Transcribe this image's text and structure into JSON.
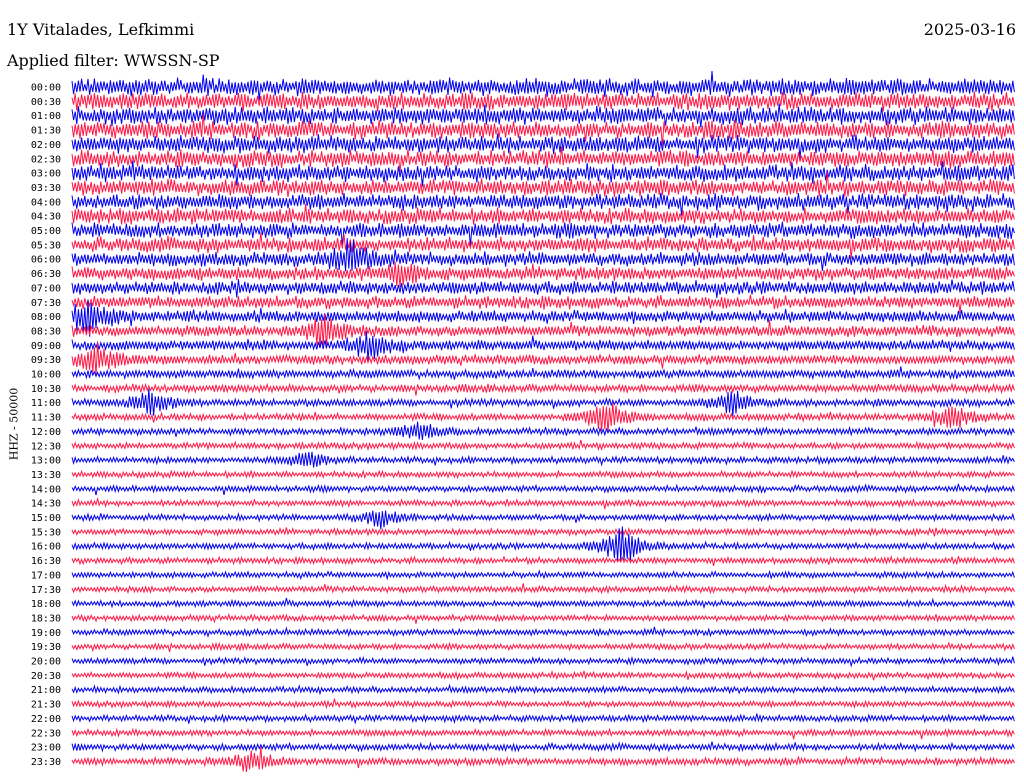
{
  "header": {
    "title": "1Y Vitalades, Lefkimmi",
    "date": "2025-03-16",
    "filter": "Applied filter: WWSSN-SP"
  },
  "chart_data": {
    "type": "line",
    "ylabel": "HHZ - 50000",
    "ytick_labels": [
      "00:00",
      "00:30",
      "01:00",
      "01:30",
      "02:00",
      "02:30",
      "03:00",
      "03:30",
      "04:00",
      "04:30",
      "05:00",
      "05:30",
      "06:00",
      "06:30",
      "07:00",
      "07:30",
      "08:00",
      "08:30",
      "09:00",
      "09:30",
      "10:00",
      "10:30",
      "11:00",
      "11:30",
      "12:00",
      "12:30",
      "13:00",
      "13:30",
      "14:00",
      "14:30",
      "15:00",
      "15:30",
      "16:00",
      "16:30",
      "17:00",
      "17:30",
      "18:00",
      "18:30",
      "19:00",
      "19:30",
      "20:00",
      "20:30",
      "21:00",
      "21:30",
      "22:00",
      "22:30",
      "23:00",
      "23:30"
    ],
    "trace_colors": [
      "#0000ee",
      "#ff1744"
    ],
    "trace_colors_note": "traces alternate blue/red",
    "noise_amplitude_by_row": [
      1.0,
      1.0,
      1.0,
      1.0,
      1.0,
      0.98,
      0.95,
      0.95,
      0.92,
      0.9,
      0.88,
      0.85,
      0.8,
      0.78,
      0.75,
      0.72,
      0.68,
      0.62,
      0.58,
      0.55,
      0.48,
      0.45,
      0.42,
      0.4,
      0.38,
      0.37,
      0.36,
      0.35,
      0.35,
      0.35,
      0.35,
      0.35,
      0.35,
      0.35,
      0.34,
      0.34,
      0.34,
      0.34,
      0.34,
      0.34,
      0.34,
      0.34,
      0.34,
      0.34,
      0.35,
      0.36,
      0.38,
      0.4
    ],
    "events": [
      {
        "row": 12,
        "minute": 9.0,
        "amp": 1.6
      },
      {
        "row": 13,
        "minute": 10.5,
        "amp": 1.2
      },
      {
        "row": 16,
        "minute": 0.5,
        "amp": 1.8
      },
      {
        "row": 17,
        "minute": 8.0,
        "amp": 1.8
      },
      {
        "row": 18,
        "minute": 9.5,
        "amp": 1.5
      },
      {
        "row": 19,
        "minute": 0.8,
        "amp": 1.5
      },
      {
        "row": 22,
        "minute": 2.5,
        "amp": 1.4
      },
      {
        "row": 22,
        "minute": 21.0,
        "amp": 1.2
      },
      {
        "row": 23,
        "minute": 17.0,
        "amp": 1.8
      },
      {
        "row": 23,
        "minute": 28.0,
        "amp": 1.3
      },
      {
        "row": 24,
        "minute": 11.0,
        "amp": 1.0
      },
      {
        "row": 26,
        "minute": 7.5,
        "amp": 0.9
      },
      {
        "row": 30,
        "minute": 9.8,
        "amp": 1.0
      },
      {
        "row": 32,
        "minute": 17.5,
        "amp": 2.2
      },
      {
        "row": 47,
        "minute": 5.7,
        "amp": 1.2
      }
    ]
  }
}
